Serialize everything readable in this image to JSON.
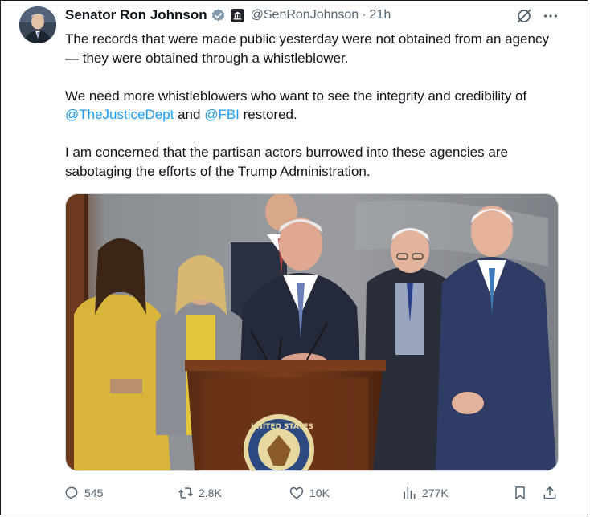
{
  "author": {
    "display_name": "Senator Ron Johnson",
    "handle": "@SenRonJohnson",
    "separator": "·",
    "timestamp": "21h",
    "verified": true,
    "government_badge": true
  },
  "tweet": {
    "paragraph_1": "The records that were made public yesterday were not obtained from an agency — they were obtained through a whistleblower.",
    "paragraph_2_before": "We need more whistleblowers who want to see the integrity and credibility of ",
    "mention_1": "@TheJusticeDept",
    "paragraph_2_middle": " and ",
    "mention_2": "@FBI",
    "paragraph_2_after": " restored.",
    "paragraph_3": "I am concerned that the partisan actors burrowed into these agencies are sabotaging the efforts of the Trump Administration."
  },
  "media": {
    "seal_text": "UNITED STATES"
  },
  "metrics": {
    "replies": "545",
    "reposts": "2.8K",
    "likes": "10K",
    "views": "277K"
  },
  "colors": {
    "accent": "#1d9bf0",
    "secondary_text": "#536471",
    "primary_text": "#0f1419",
    "verified_badge": "#829aab"
  },
  "icons": {
    "header": [
      "verified-badge-icon",
      "government-badge-icon",
      "grok-icon",
      "more-options-icon"
    ],
    "actions": [
      "reply-icon",
      "repost-icon",
      "like-icon",
      "views-icon",
      "bookmark-icon",
      "share-icon"
    ]
  }
}
